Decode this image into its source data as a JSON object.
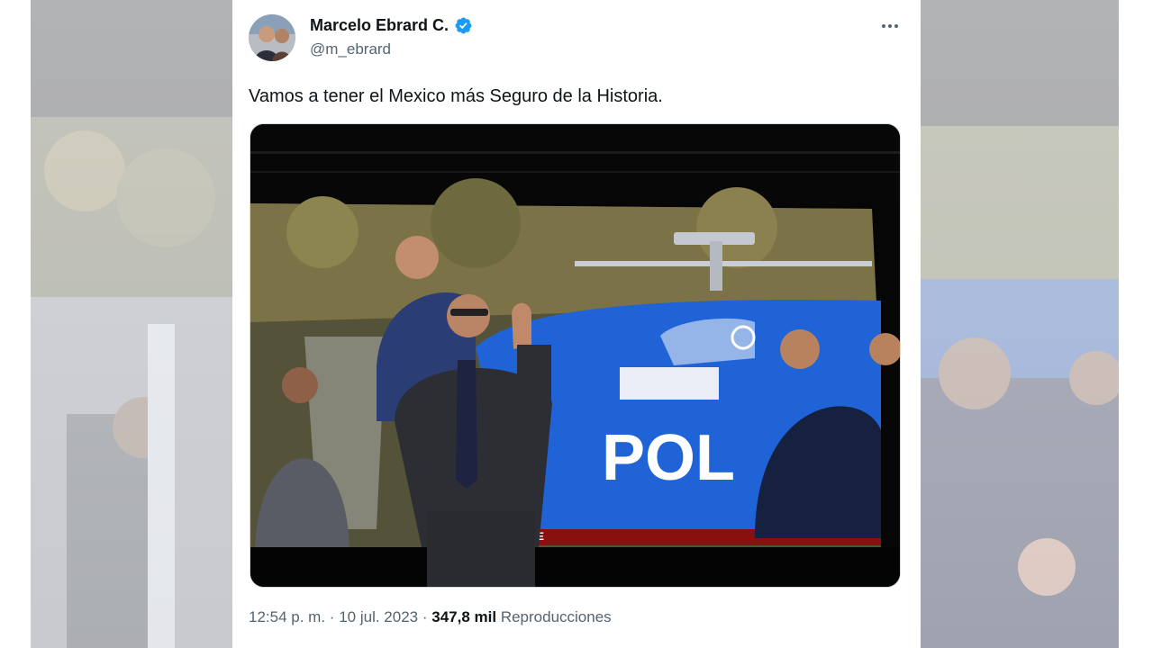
{
  "author": {
    "name": "Marcelo Ebrard C.",
    "handle": "@m_ebrard",
    "verified": true
  },
  "tweet": {
    "text": "Vamos a tener el Mexico más Seguro de la Historia.",
    "time": "12:54 p. m.",
    "separator": "·",
    "date": "10 jul. 2023",
    "views_count": "347,8 mil",
    "views_label": "Reproducciones"
  },
  "media": {
    "helicopter_text": "POL",
    "helicopter_tag": "E"
  },
  "colors": {
    "verified_blue": "#1d9bf0",
    "text_primary": "#0f1419",
    "text_secondary": "#536471",
    "helicopter_blue": "#1f63d6"
  },
  "icons": {
    "verified": "verified-badge-icon",
    "more": "more-options-icon"
  }
}
